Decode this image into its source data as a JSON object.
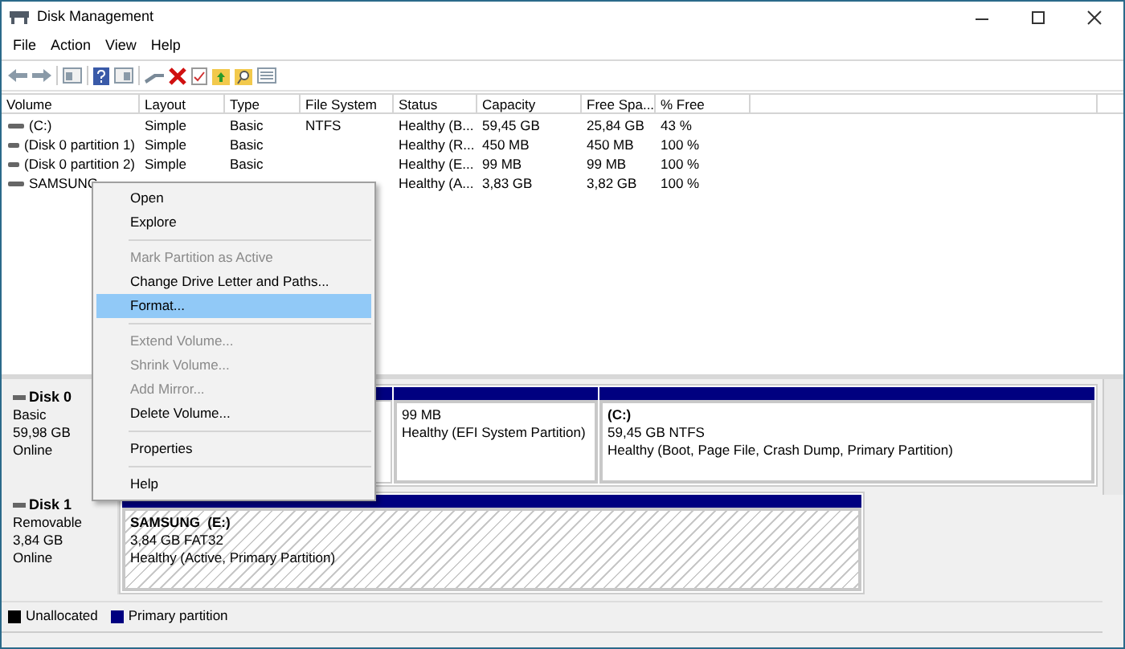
{
  "window": {
    "title": "Disk Management"
  },
  "menu_bar": [
    "File",
    "Action",
    "View",
    "Help"
  ],
  "table": {
    "columns": [
      "Volume",
      "Layout",
      "Type",
      "File System",
      "Status",
      "Capacity",
      "Free Spa...",
      "% Free"
    ],
    "rows": [
      {
        "cells": [
          "(C:)",
          "Simple",
          "Basic",
          "NTFS",
          "Healthy (B...",
          "59,45 GB",
          "25,84 GB",
          "43 %"
        ]
      },
      {
        "cells": [
          "(Disk 0 partition 1)",
          "Simple",
          "Basic",
          "",
          "Healthy (R...",
          "450 MB",
          "450 MB",
          "100 %"
        ]
      },
      {
        "cells": [
          "(Disk 0 partition 2)",
          "Simple",
          "Basic",
          "",
          "Healthy (E...",
          "99 MB",
          "99 MB",
          "100 %"
        ]
      },
      {
        "cells": [
          "SAMSUNG",
          "",
          "",
          "",
          "Healthy (A...",
          "3,83 GB",
          "3,82 GB",
          "100 %"
        ]
      }
    ]
  },
  "disks": [
    {
      "name": "Disk 0",
      "type": "Basic",
      "size": "59,98 GB",
      "state": "Online",
      "partitions": [
        {
          "kind": "covered"
        },
        {
          "kind": "volume",
          "lines": [
            "99 MB",
            "Healthy (EFI System Partition)"
          ],
          "hatched": false
        },
        {
          "kind": "volume",
          "title": "(C:)",
          "lines": [
            "59,45 GB NTFS",
            "Healthy (Boot, Page File, Crash Dump, Primary Partition)"
          ],
          "hatched": false
        }
      ]
    },
    {
      "name": "Disk 1",
      "type": "Removable",
      "size": "3,84 GB",
      "state": "Online",
      "partitions": [
        {
          "kind": "volume",
          "title": "SAMSUNG  (E:)",
          "lines": [
            "3,84 GB FAT32",
            "Healthy (Active, Primary Partition)"
          ],
          "hatched": true
        }
      ]
    }
  ],
  "legend": [
    {
      "label": "Unallocated",
      "color": "#000000"
    },
    {
      "label": "Primary partition",
      "color": "#000080"
    }
  ],
  "context_menu": [
    {
      "kind": "item",
      "label": "Open",
      "disabled": false,
      "selected": false
    },
    {
      "kind": "item",
      "label": "Explore",
      "disabled": false,
      "selected": false
    },
    {
      "kind": "separator"
    },
    {
      "kind": "item",
      "label": "Mark Partition as Active",
      "disabled": true,
      "selected": false
    },
    {
      "kind": "item",
      "label": "Change Drive Letter and Paths...",
      "disabled": false,
      "selected": false
    },
    {
      "kind": "item",
      "label": "Format...",
      "disabled": false,
      "selected": true
    },
    {
      "kind": "separator"
    },
    {
      "kind": "item",
      "label": "Extend Volume...",
      "disabled": true,
      "selected": false
    },
    {
      "kind": "item",
      "label": "Shrink Volume...",
      "disabled": true,
      "selected": false
    },
    {
      "kind": "item",
      "label": "Add Mirror...",
      "disabled": true,
      "selected": false
    },
    {
      "kind": "item",
      "label": "Delete Volume...",
      "disabled": false,
      "selected": false
    },
    {
      "kind": "separator"
    },
    {
      "kind": "item",
      "label": "Properties",
      "disabled": false,
      "selected": false
    },
    {
      "kind": "separator"
    },
    {
      "kind": "item",
      "label": "Help",
      "disabled": false,
      "selected": false
    }
  ]
}
